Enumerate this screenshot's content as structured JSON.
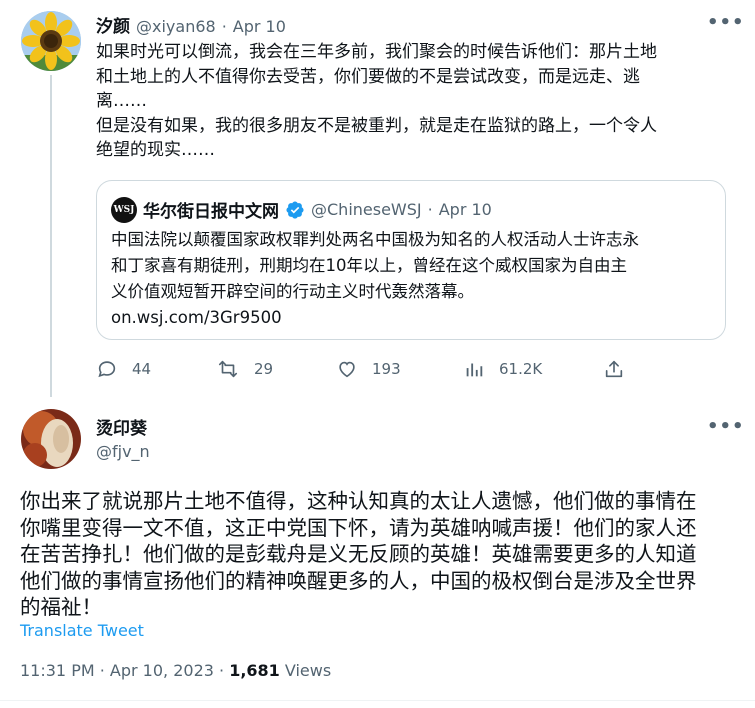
{
  "tweet": {
    "author_name": "汐颜",
    "author_handle": "@xiyan68",
    "separator": "·",
    "date": "Apr 10",
    "text_lines": [
      "如果时光可以倒流，我会在三年多前，我们聚会的时候告诉他们：那片土地",
      "和土地上的人不值得你去受苦，你们要做的不是尝试改变，而是远走、逃",
      "离……",
      "但是没有如果，我的很多朋友不是被重判，就是走在监狱的路上，一个令人",
      "绝望的现实……"
    ],
    "quote": {
      "logo_text": "WSJ",
      "author_name": "华尔街日报中文网",
      "author_handle": "@ChineseWSJ",
      "separator": "·",
      "date": "Apr 10",
      "text_lines": [
        "中国法院以颠覆国家政权罪判处两名中国极为知名的人权活动人士许志永",
        "和丁家喜有期徒刑，刑期均在10年以上，曾经在这个威权国家为自由主",
        "义价值观短暂开辟空间的行动主义时代轰然落幕。"
      ],
      "link": "on.wsj.com/3Gr9500"
    },
    "actions": {
      "replies": "44",
      "retweets": "29",
      "likes": "193",
      "views": "61.2K"
    }
  },
  "reply": {
    "author_name": "烫印葵",
    "author_handle": "@fjv_n",
    "text_lines": [
      "你出来了就说那片土地不值得，这种认知真的太让人遗憾，他们做的事情在",
      "你嘴里变得一文不值，这正中党国下怀，请为英雄呐喊声援！他们的家人还",
      "在苦苦挣扎！他们做的是彭载舟是义无反顾的英雄！英雄需要更多的人知道",
      "他们做的事情宣扬他们的精神唤醒更多的人，中国的极权倒台是涉及全世界",
      "的福祉！"
    ],
    "translate_label": "Translate Tweet",
    "timestamp": "11:31 PM · Apr 10, 2023 · ",
    "views_count": "1,681",
    "views_label": " Views"
  },
  "more_label": "•••",
  "colors": {
    "accent": "#1d9bf0",
    "muted": "#536471",
    "text": "#0f1419"
  }
}
